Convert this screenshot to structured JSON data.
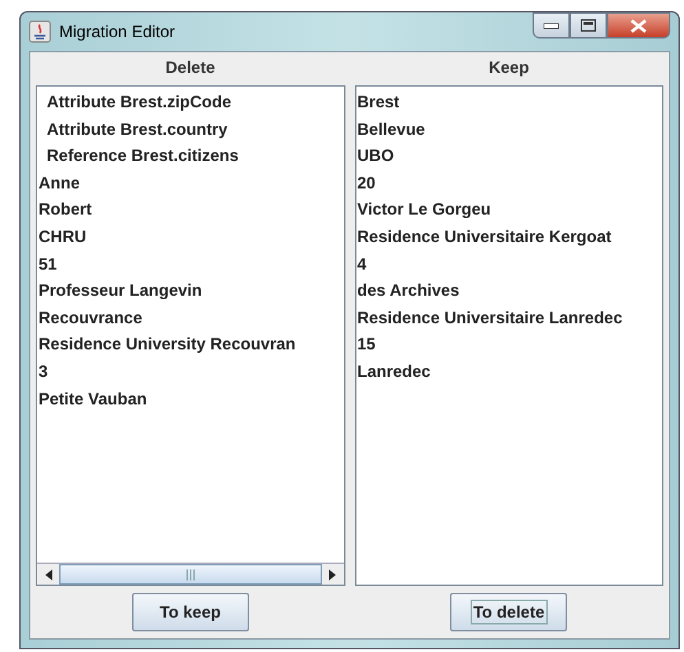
{
  "window": {
    "title": "Migration Editor"
  },
  "columns": [
    {
      "header": "Delete",
      "items": [
        {
          "text": "Attribute Brest.zipCode",
          "kind": "feature"
        },
        {
          "text": "Attribute Brest.country",
          "kind": "feature"
        },
        {
          "text": "Reference Brest.citizens",
          "kind": "feature"
        },
        {
          "text": "Anne",
          "kind": "value"
        },
        {
          "text": "Robert",
          "kind": "value"
        },
        {
          "text": "CHRU",
          "kind": "value"
        },
        {
          "text": "51",
          "kind": "value"
        },
        {
          "text": "Professeur Langevin",
          "kind": "value"
        },
        {
          "text": "Recouvrance",
          "kind": "value"
        },
        {
          "text": "Residence University Recouvran",
          "kind": "value"
        },
        {
          "text": "3",
          "kind": "value"
        },
        {
          "text": "Petite Vauban",
          "kind": "value"
        }
      ],
      "scrollbar": true,
      "button": {
        "label": "To keep",
        "focused": false
      }
    },
    {
      "header": "Keep",
      "items": [
        {
          "text": "Brest",
          "kind": "value"
        },
        {
          "text": "Bellevue",
          "kind": "value"
        },
        {
          "text": "UBO",
          "kind": "value"
        },
        {
          "text": "20",
          "kind": "value"
        },
        {
          "text": "Victor Le Gorgeu",
          "kind": "value"
        },
        {
          "text": "Residence Universitaire Kergoat",
          "kind": "value"
        },
        {
          "text": "4",
          "kind": "value"
        },
        {
          "text": "des Archives",
          "kind": "value"
        },
        {
          "text": "Residence Universitaire Lanredec",
          "kind": "value"
        },
        {
          "text": "15",
          "kind": "value"
        },
        {
          "text": "Lanredec",
          "kind": "value"
        }
      ],
      "scrollbar": false,
      "button": {
        "label": "To delete",
        "focused": true
      }
    }
  ]
}
